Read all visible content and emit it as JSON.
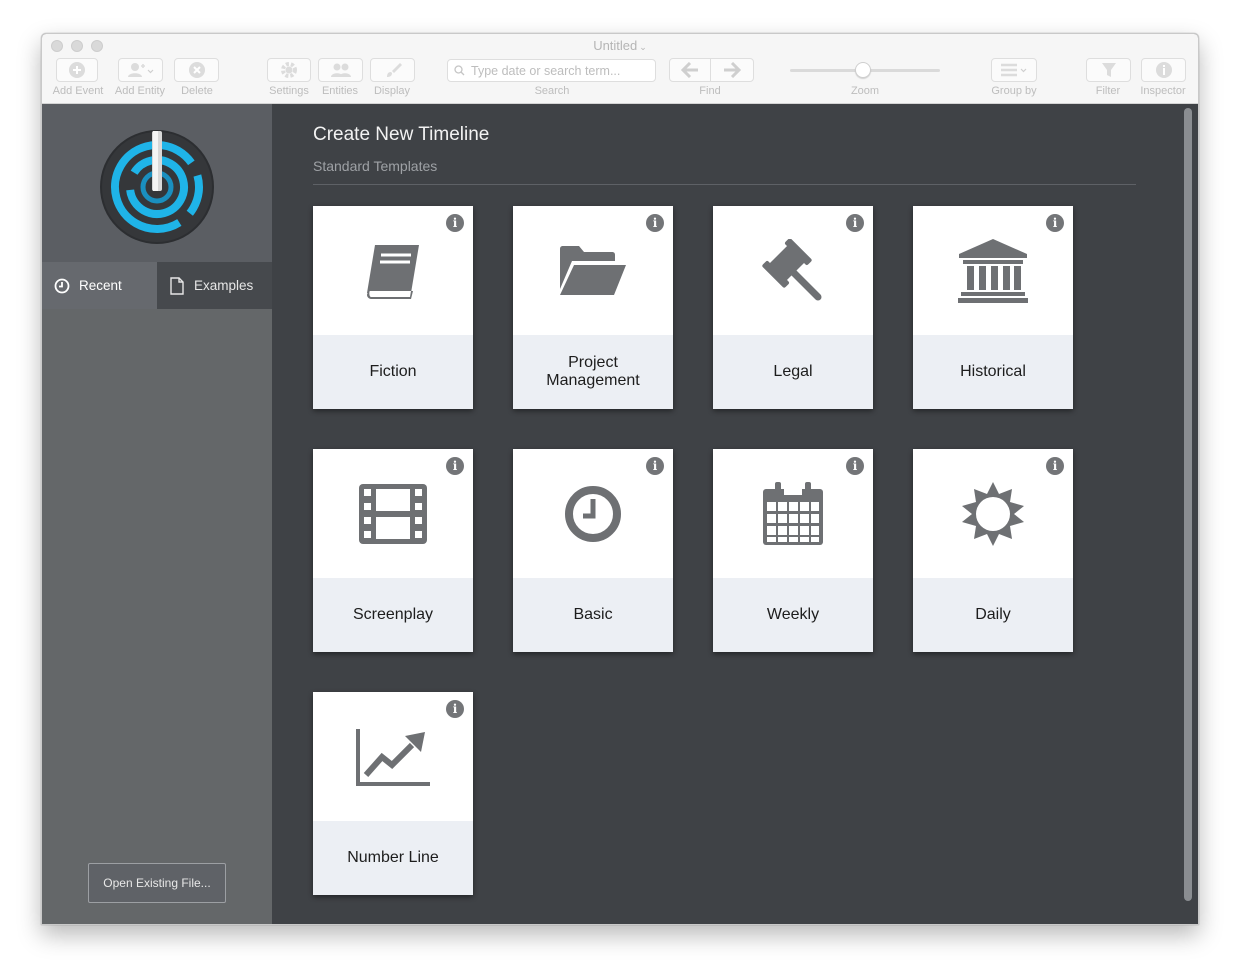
{
  "window": {
    "title": "Untitled"
  },
  "toolbar": {
    "add_event": "Add Event",
    "add_entity": "Add Entity",
    "delete": "Delete",
    "settings": "Settings",
    "entities": "Entities",
    "display": "Display",
    "search_placeholder": "Type date or search term...",
    "search_label": "Search",
    "find_label": "Find",
    "zoom_label": "Zoom",
    "zoom_level": 0.5,
    "group_by": "Group by",
    "filter": "Filter",
    "inspector": "Inspector"
  },
  "sidebar": {
    "tabs": [
      {
        "label": "Recent",
        "icon": "clock-icon",
        "selected": true
      },
      {
        "label": "Examples",
        "icon": "document-icon",
        "selected": false
      }
    ],
    "open_button": "Open Existing File..."
  },
  "main": {
    "title": "Create New Timeline",
    "subtitle": "Standard Templates",
    "info_glyph": "i",
    "templates": [
      {
        "label": "Fiction",
        "icon": "book-icon"
      },
      {
        "label": "Project Management",
        "icon": "folder-icon"
      },
      {
        "label": "Legal",
        "icon": "gavel-icon"
      },
      {
        "label": "Historical",
        "icon": "museum-icon"
      },
      {
        "label": "Screenplay",
        "icon": "film-icon"
      },
      {
        "label": "Basic",
        "icon": "clock-icon"
      },
      {
        "label": "Weekly",
        "icon": "calendar-icon"
      },
      {
        "label": "Daily",
        "icon": "sun-icon"
      },
      {
        "label": "Number Line",
        "icon": "line-chart-icon"
      }
    ]
  },
  "colors": {
    "sidebar": "#5a5d62",
    "main_background": "#3f4246",
    "icon_gray": "#6e7073",
    "card_label_background": "#eceff4",
    "logo_accent": "#1fb4e8"
  }
}
